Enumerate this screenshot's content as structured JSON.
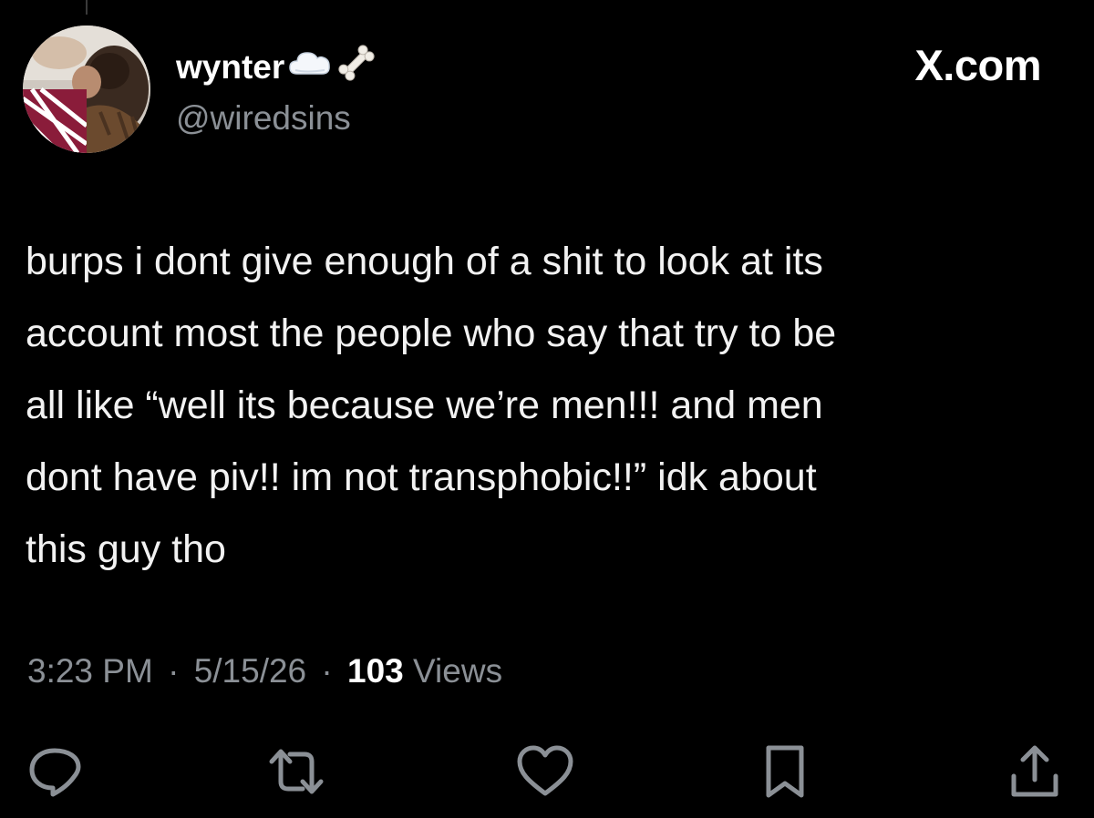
{
  "author": {
    "display_name": "wynter",
    "name_emojis": [
      "cloud-emoji",
      "bone-emoji"
    ],
    "handle": "@wiredsins"
  },
  "source_label": "X.com",
  "tweet": {
    "lines": [
      "burps i dont give enough of a shit to look at its",
      "account most the people who say that try to be",
      "all like “well its because we’re men!!! and men",
      "dont have piv!! im not transphobic!!” idk about",
      "this guy tho"
    ]
  },
  "meta": {
    "time": "3:23 PM",
    "date": "5/15/26",
    "separator": "·",
    "views_count": "103",
    "views_label": "Views"
  },
  "actions": [
    {
      "name": "reply",
      "icon": "reply-icon"
    },
    {
      "name": "repost",
      "icon": "repost-icon"
    },
    {
      "name": "like",
      "icon": "heart-icon"
    },
    {
      "name": "bookmark",
      "icon": "bookmark-icon"
    },
    {
      "name": "share",
      "icon": "share-icon"
    }
  ],
  "colors": {
    "background": "#000000",
    "text": "#f2f2f2",
    "secondary": "#8b9096",
    "icon": "#8b9096"
  }
}
